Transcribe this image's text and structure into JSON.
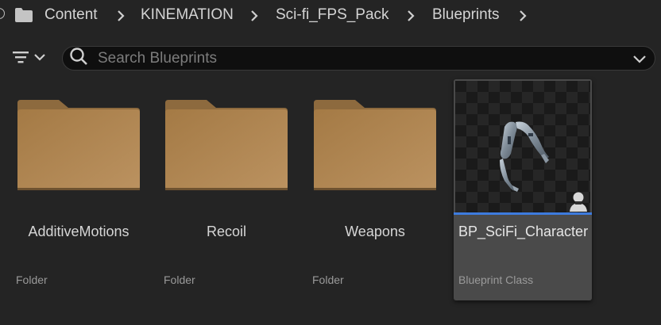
{
  "breadcrumb": {
    "items": [
      "Content",
      "KINEMATION",
      "Sci-fi_FPS_Pack",
      "Blueprints"
    ]
  },
  "search": {
    "placeholder": "Search Blueprints",
    "value": ""
  },
  "assets": [
    {
      "label": "AdditiveMotions",
      "type": "Folder"
    },
    {
      "label": "Recoil",
      "type": "Folder"
    },
    {
      "label": "Weapons",
      "type": "Folder"
    },
    {
      "label": "BP_SciFi_Character",
      "type": "Blueprint Class"
    }
  ],
  "colors": {
    "background": "#242424",
    "folder": "#b08650",
    "selection_accent": "#3d7bde",
    "tile_selected": "#4a4a4a"
  },
  "icons": [
    "folder-icon",
    "chevron-right-icon",
    "filter-icon",
    "chevron-down-icon",
    "search-icon",
    "character-class-icon"
  ]
}
